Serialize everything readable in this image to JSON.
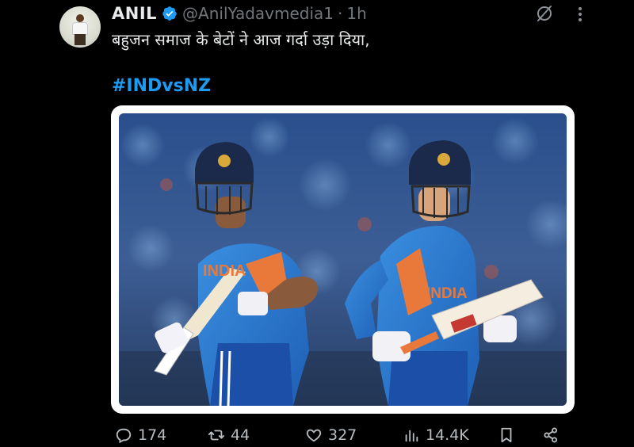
{
  "author": {
    "name": "ANIL",
    "handle": "@AnilYadavmedia1",
    "separator": "·",
    "time": "1h"
  },
  "tweet": {
    "text": "बहुजन समाज के बेटों ने आज गर्दा उड़ा दिया,",
    "hashtag": "#INDvsNZ"
  },
  "metrics": {
    "replies": "174",
    "reposts": "44",
    "likes": "327",
    "views": "14.4K"
  },
  "colors": {
    "background": "#000000",
    "text": "#e7e9ea",
    "muted": "#71767b",
    "accent": "#1d9bf0"
  },
  "icons": [
    "verified-badge-icon",
    "mute-icon",
    "more-icon",
    "reply-icon",
    "repost-icon",
    "like-icon",
    "views-icon",
    "bookmark-icon",
    "share-icon"
  ]
}
